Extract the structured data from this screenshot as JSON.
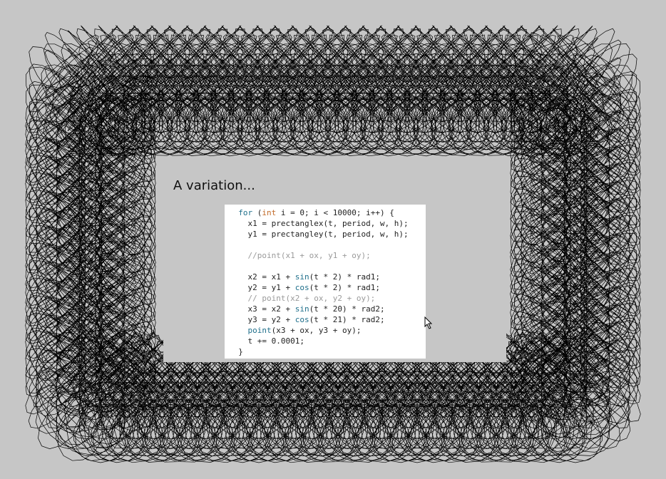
{
  "title": "A variation...",
  "code": [
    {
      "indent": "  ",
      "tokens": [
        {
          "t": "for",
          "c": "kw"
        },
        {
          "t": " (",
          "c": ""
        },
        {
          "t": "int",
          "c": "type"
        },
        {
          "t": " i = 0; i < 10000; i++) {",
          "c": ""
        }
      ]
    },
    {
      "indent": "    ",
      "tokens": [
        {
          "t": "x1 = prectanglex(t, period, w, h);",
          "c": ""
        }
      ]
    },
    {
      "indent": "    ",
      "tokens": [
        {
          "t": "y1 = prectangley(t, period, w, h);",
          "c": ""
        }
      ]
    },
    {
      "indent": "",
      "tokens": []
    },
    {
      "indent": "    ",
      "tokens": [
        {
          "t": "//point(x1 + ox, y1 + oy);",
          "c": "comment"
        }
      ]
    },
    {
      "indent": "",
      "tokens": []
    },
    {
      "indent": "    ",
      "tokens": [
        {
          "t": "x2 = x1 + ",
          "c": ""
        },
        {
          "t": "sin",
          "c": "fn"
        },
        {
          "t": "(t * 2) * rad1;",
          "c": ""
        }
      ]
    },
    {
      "indent": "    ",
      "tokens": [
        {
          "t": "y2 = y1 + ",
          "c": ""
        },
        {
          "t": "cos",
          "c": "fn"
        },
        {
          "t": "(t * 2) * rad1;",
          "c": ""
        }
      ]
    },
    {
      "indent": "    ",
      "tokens": [
        {
          "t": "// point(x2 + ox, y2 + oy);",
          "c": "comment"
        }
      ]
    },
    {
      "indent": "    ",
      "tokens": [
        {
          "t": "x3 = x2 + ",
          "c": ""
        },
        {
          "t": "sin",
          "c": "fn"
        },
        {
          "t": "(t * 20) * rad2;",
          "c": ""
        }
      ]
    },
    {
      "indent": "    ",
      "tokens": [
        {
          "t": "y3 = y2 + ",
          "c": ""
        },
        {
          "t": "cos",
          "c": "fn"
        },
        {
          "t": "(t * 21) * rad2;",
          "c": ""
        }
      ]
    },
    {
      "indent": "    ",
      "tokens": [
        {
          "t": "point",
          "c": "fn"
        },
        {
          "t": "(x3 + ox, y3 + oy);",
          "c": ""
        }
      ]
    },
    {
      "indent": "    ",
      "tokens": [
        {
          "t": "t += 0.0001;",
          "c": ""
        }
      ]
    },
    {
      "indent": "  ",
      "tokens": [
        {
          "t": "}",
          "c": ""
        }
      ]
    }
  ],
  "icons": {
    "cursor": "mouse-pointer-icon"
  },
  "colors": {
    "background": "#c6c6c6",
    "ink": "#000000",
    "code_background": "#ffffff",
    "keyword": "#1f6f8b",
    "type": "#c26b2a",
    "comment": "#9a9a9a"
  }
}
